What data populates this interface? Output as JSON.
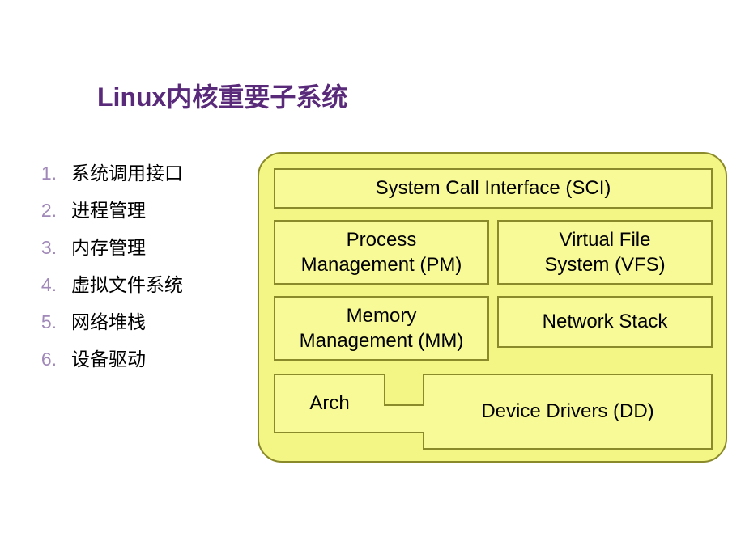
{
  "title": "Linux内核重要子系统",
  "list": [
    {
      "num": "1.",
      "text": "系统调用接口"
    },
    {
      "num": "2.",
      "text": "进程管理"
    },
    {
      "num": "3.",
      "text": "内存管理"
    },
    {
      "num": "4.",
      "text": "虚拟文件系统"
    },
    {
      "num": "5.",
      "text": "网络堆栈"
    },
    {
      "num": "6.",
      "text": "设备驱动"
    }
  ],
  "diagram": {
    "sci": "System Call Interface (SCI)",
    "pm_l1": "Process",
    "pm_l2": "Management (PM)",
    "vfs_l1": "Virtual File",
    "vfs_l2": "System (VFS)",
    "mm_l1": "Memory",
    "mm_l2": "Management (MM)",
    "ns": "Network Stack",
    "arch": "Arch",
    "dd": "Device Drivers (DD)"
  }
}
